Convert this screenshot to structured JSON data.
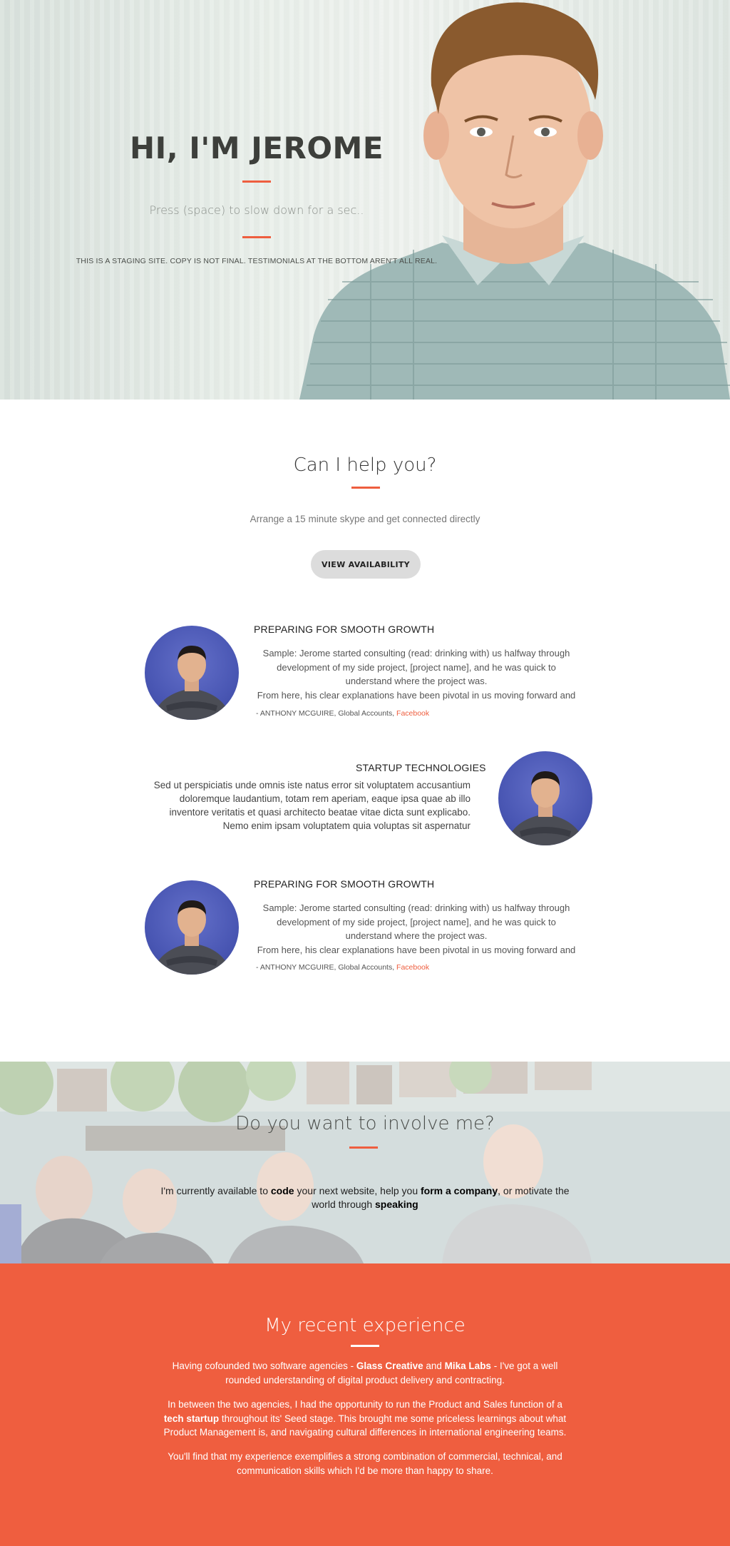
{
  "hero": {
    "title": "HI, I'M JEROME",
    "subtitle": "Press (space) to slow down for a sec..",
    "note": "THIS IS A STAGING SITE. COPY IS NOT FINAL. TESTIMONIALS AT THE BOTTOM AREN'T ALL REAL."
  },
  "help": {
    "title": "Can I help you?",
    "subtitle": "Arrange a 15 minute skype and get connected directly",
    "button_label": "VIEW AVAILABILITY"
  },
  "testimonials": [
    {
      "title": "PREPARING FOR SMOOTH GROWTH",
      "lines": [
        "Sample: Jerome started consulting (read: drinking with) us halfway through",
        "development of my side project, [project name], and he was quick to",
        "understand where the project was.",
        "From here, his clear explanations have been pivotal in us moving forward and"
      ],
      "author": "- ANTHONY MCGUIRE, Global Accounts, ",
      "company": "Facebook"
    },
    {
      "title": "STARTUP TECHNOLOGIES",
      "lines": [
        "Sed ut perspiciatis unde omnis iste natus error sit voluptatem accusantium",
        "doloremque laudantium, totam rem aperiam, eaque ipsa quae ab illo",
        "inventore veritatis et quasi architecto beatae vitae dicta sunt explicabo.",
        "Nemo enim ipsam voluptatem quia voluptas sit aspernatur"
      ]
    },
    {
      "title": "PREPARING FOR SMOOTH GROWTH",
      "lines": [
        "Sample: Jerome started consulting (read: drinking with) us halfway through",
        "development of my side project, [project name], and he was quick to",
        "understand where the project was.",
        "From here, his clear explanations have been pivotal in us moving forward and"
      ],
      "author": "- ANTHONY MCGUIRE, Global Accounts, ",
      "company": "Facebook"
    }
  ],
  "involve": {
    "title": "Do you want to involve me?",
    "text_1": "I'm currently available to ",
    "bold_1": "code",
    "text_2": " your next website, help you ",
    "bold_2": "form a company",
    "text_3": ", or motivate the world through ",
    "bold_3": "speaking"
  },
  "experience": {
    "title": "My recent experience",
    "p1_a": "Having cofounded two software agencies - ",
    "p1_b": "Glass Creative",
    "p1_c": " and ",
    "p1_d": "Mika Labs",
    "p1_e": " - I've got a well rounded understanding of digital product delivery and contracting.",
    "p2_a": "In between the two agencies, I had the opportunity to run the Product and Sales function of a ",
    "p2_b": "tech startup",
    "p2_c": " throughout its' Seed stage. This brought me some priceless learnings about what Product Management is, and navigating cultural differences in international engineering teams.",
    "p3": "You'll find that my experience exemplifies a strong combination of commercial, technical, and communication skills which I'd be more than happy to share."
  },
  "colors": {
    "accent": "#ee5e3f",
    "experience_bg": "#ef5e3f",
    "button_bg": "#dcdcdc",
    "avatar_bg": "#4a57b4"
  }
}
